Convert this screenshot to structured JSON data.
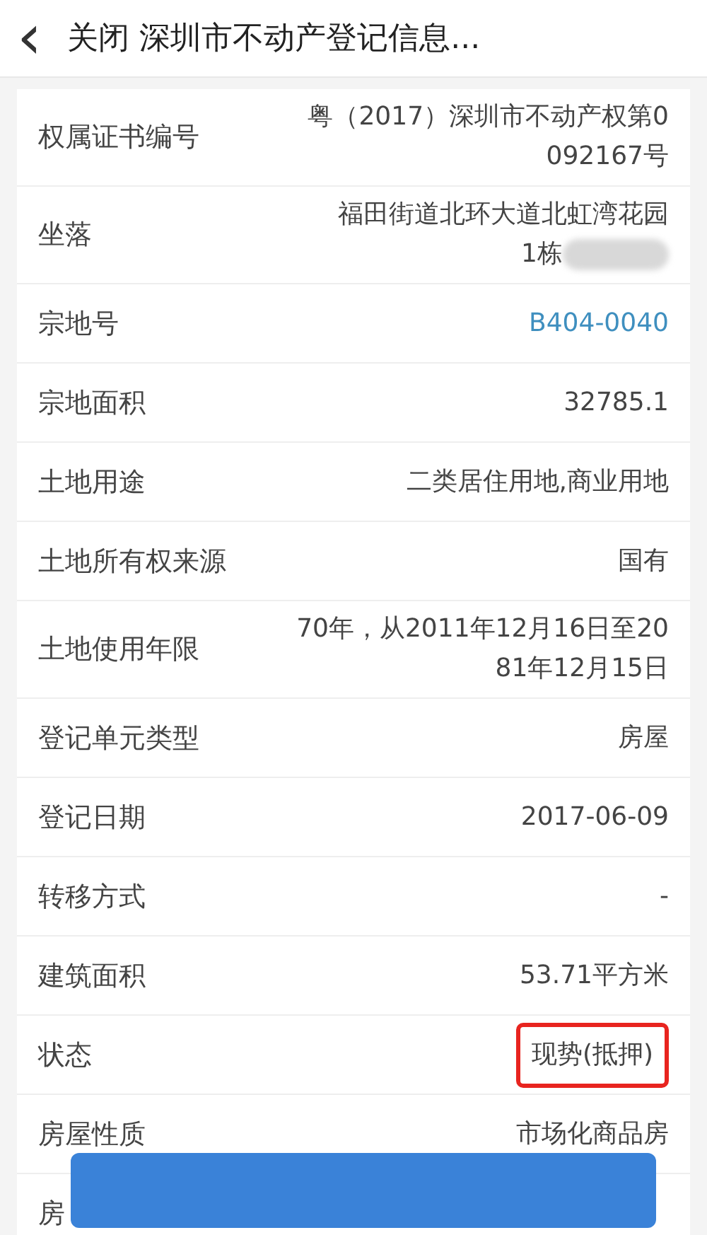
{
  "header": {
    "back": "‹",
    "title": "关闭 深圳市不动产登记信息..."
  },
  "rows": [
    {
      "label": "权属证书编号",
      "value": "粤（2017）深圳市不动产权第0092167号",
      "kind": "text"
    },
    {
      "label": "坐落",
      "value": "福田街道北环大道北虹湾花园1栋",
      "kind": "text",
      "redacted": true
    },
    {
      "label": "宗地号",
      "value": "B404-0040",
      "kind": "link"
    },
    {
      "label": "宗地面积",
      "value": "32785.1",
      "kind": "text"
    },
    {
      "label": "土地用途",
      "value": "二类居住用地,商业用地",
      "kind": "text"
    },
    {
      "label": "土地所有权来源",
      "value": "国有",
      "kind": "text"
    },
    {
      "label": "土地使用年限",
      "value": "70年，从2011年12月16日至2081年12月15日",
      "kind": "text"
    },
    {
      "label": "登记单元类型",
      "value": "房屋",
      "kind": "text"
    },
    {
      "label": "登记日期",
      "value": "2017-06-09",
      "kind": "text"
    },
    {
      "label": "转移方式",
      "value": "-",
      "kind": "text"
    },
    {
      "label": "建筑面积",
      "value": "53.71平方米",
      "kind": "text"
    },
    {
      "label": "状态",
      "value": "现势(抵押)",
      "kind": "text",
      "highlighted": true
    },
    {
      "label": "房屋性质",
      "value": "市场化商品房",
      "kind": "text"
    },
    {
      "label": "房"
    }
  ],
  "bottom_button": {
    "kind": "primary"
  }
}
